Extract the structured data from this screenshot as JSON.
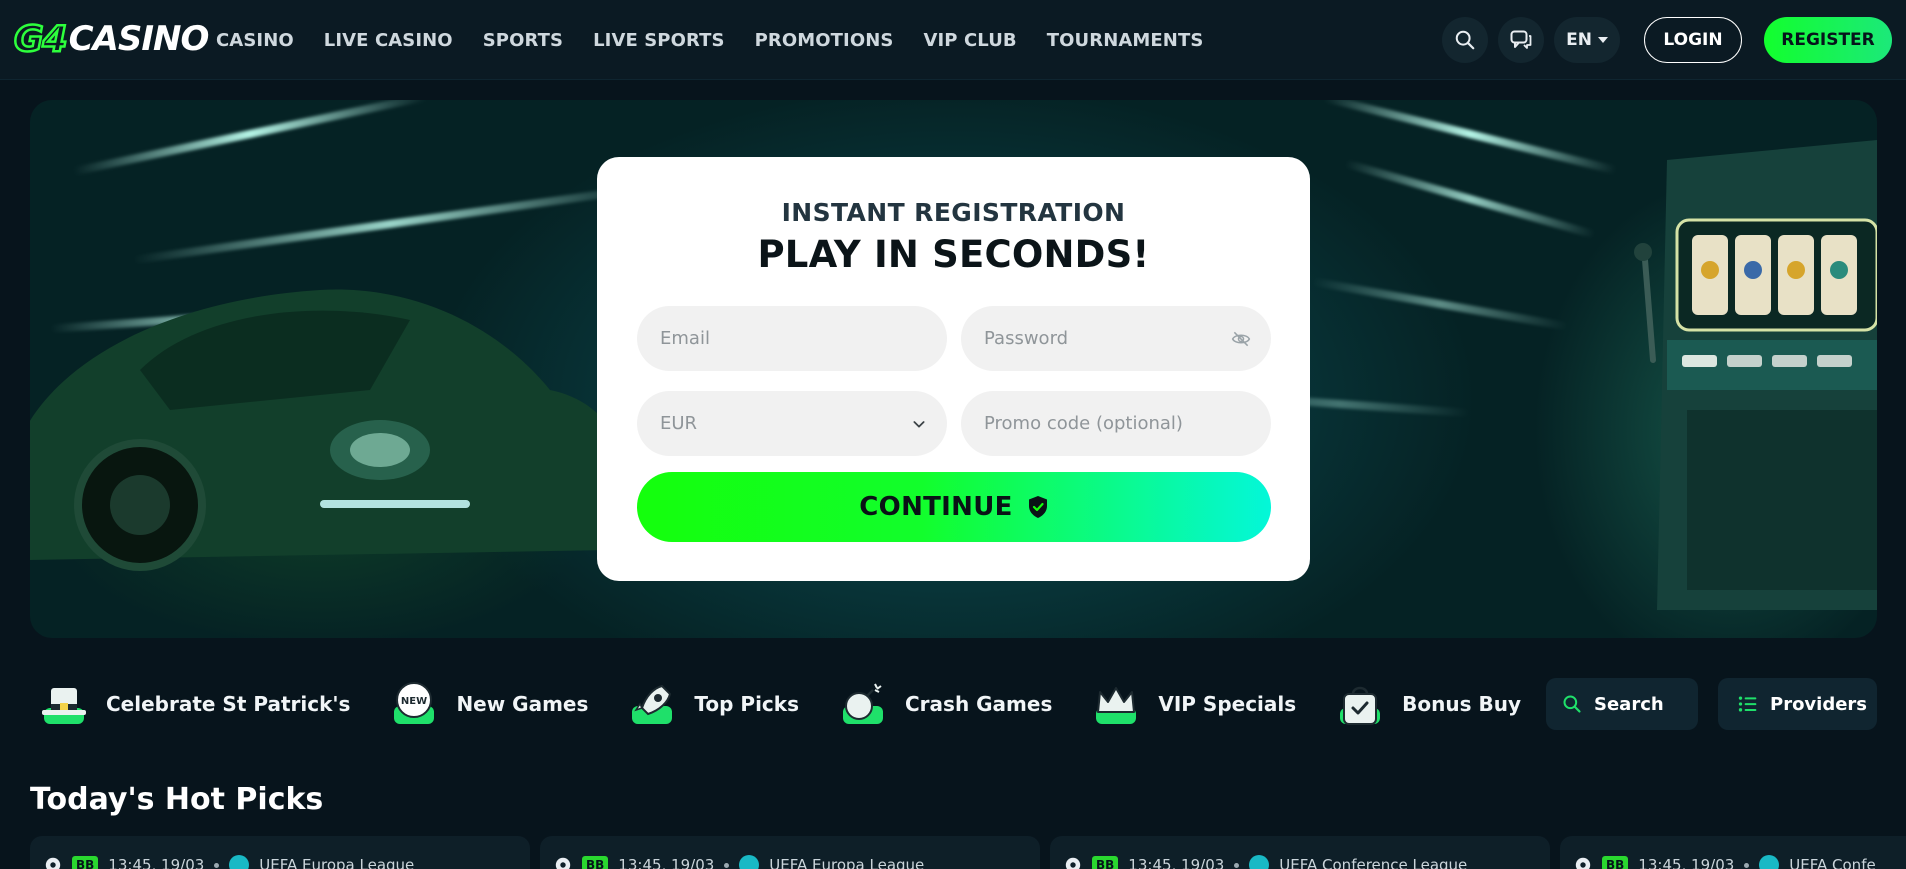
{
  "brand": {
    "logo_g4": "G4",
    "logo_casino": "CASINO"
  },
  "nav": [
    "CASINO",
    "LIVE CASINO",
    "SPORTS",
    "LIVE SPORTS",
    "PROMOTIONS",
    "VIP CLUB",
    "TOURNAMENTS"
  ],
  "header": {
    "language": "EN",
    "login_label": "LOGIN",
    "register_label": "REGISTER"
  },
  "form": {
    "kicker": "INSTANT REGISTRATION",
    "title": "PLAY IN SECONDS!",
    "email_placeholder": "Email",
    "password_placeholder": "Password",
    "currency_value": "EUR",
    "promo_placeholder": "Promo code (optional)",
    "continue_label": "CONTINUE"
  },
  "categories": [
    {
      "label": "Celebrate St Patrick's",
      "icon": "leprechaun-hat-icon"
    },
    {
      "label": "New Games",
      "icon": "new-badge-icon"
    },
    {
      "label": "Top Picks",
      "icon": "rocket-icon"
    },
    {
      "label": "Crash Games",
      "icon": "bomb-icon"
    },
    {
      "label": "VIP Specials",
      "icon": "crown-icon"
    },
    {
      "label": "Bonus Buy",
      "icon": "shopping-bag-icon"
    }
  ],
  "filters": {
    "search_label": "Search",
    "providers_label": "Providers"
  },
  "hot_picks": {
    "title": "Today's Hot Picks",
    "matches": [
      {
        "badge": "BB",
        "time": "13:45, 19/03",
        "league": "UEFA Europa League"
      },
      {
        "badge": "BB",
        "time": "13:45, 19/03",
        "league": "UEFA Europa League"
      },
      {
        "badge": "BB",
        "time": "13:45, 19/03",
        "league": "UEFA Conference League"
      },
      {
        "badge": "BB",
        "time": "13:45, 19/03",
        "league": "UEFA Confe"
      }
    ]
  },
  "colors": {
    "accent_green": "#12ff2d",
    "accent_cyan": "#04f7d9",
    "bg": "#07141c"
  }
}
